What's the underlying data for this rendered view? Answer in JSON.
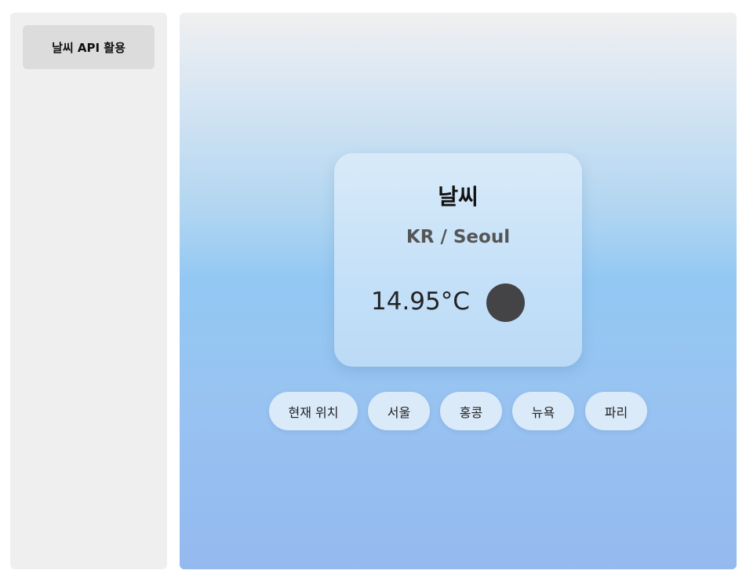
{
  "sidebar": {
    "items": [
      {
        "label": "날씨 API 활용"
      }
    ]
  },
  "weather_card": {
    "title": "날씨",
    "location": "KR / Seoul",
    "temperature": "14.95°C",
    "icon": "weather-icon"
  },
  "city_buttons": [
    {
      "label": "현재 위치"
    },
    {
      "label": "서울"
    },
    {
      "label": "홍콩"
    },
    {
      "label": "뉴욕"
    },
    {
      "label": "파리"
    }
  ],
  "colors": {
    "sidebar_bg": "#efefef",
    "sidebar_item_bg": "#dcdcdc",
    "card_bg": "#c4e0f8",
    "button_bg": "#dbeaf9",
    "weather_icon": "#444345",
    "gradient_top": "#f0f0f0",
    "gradient_bottom": "#94b9ef"
  }
}
